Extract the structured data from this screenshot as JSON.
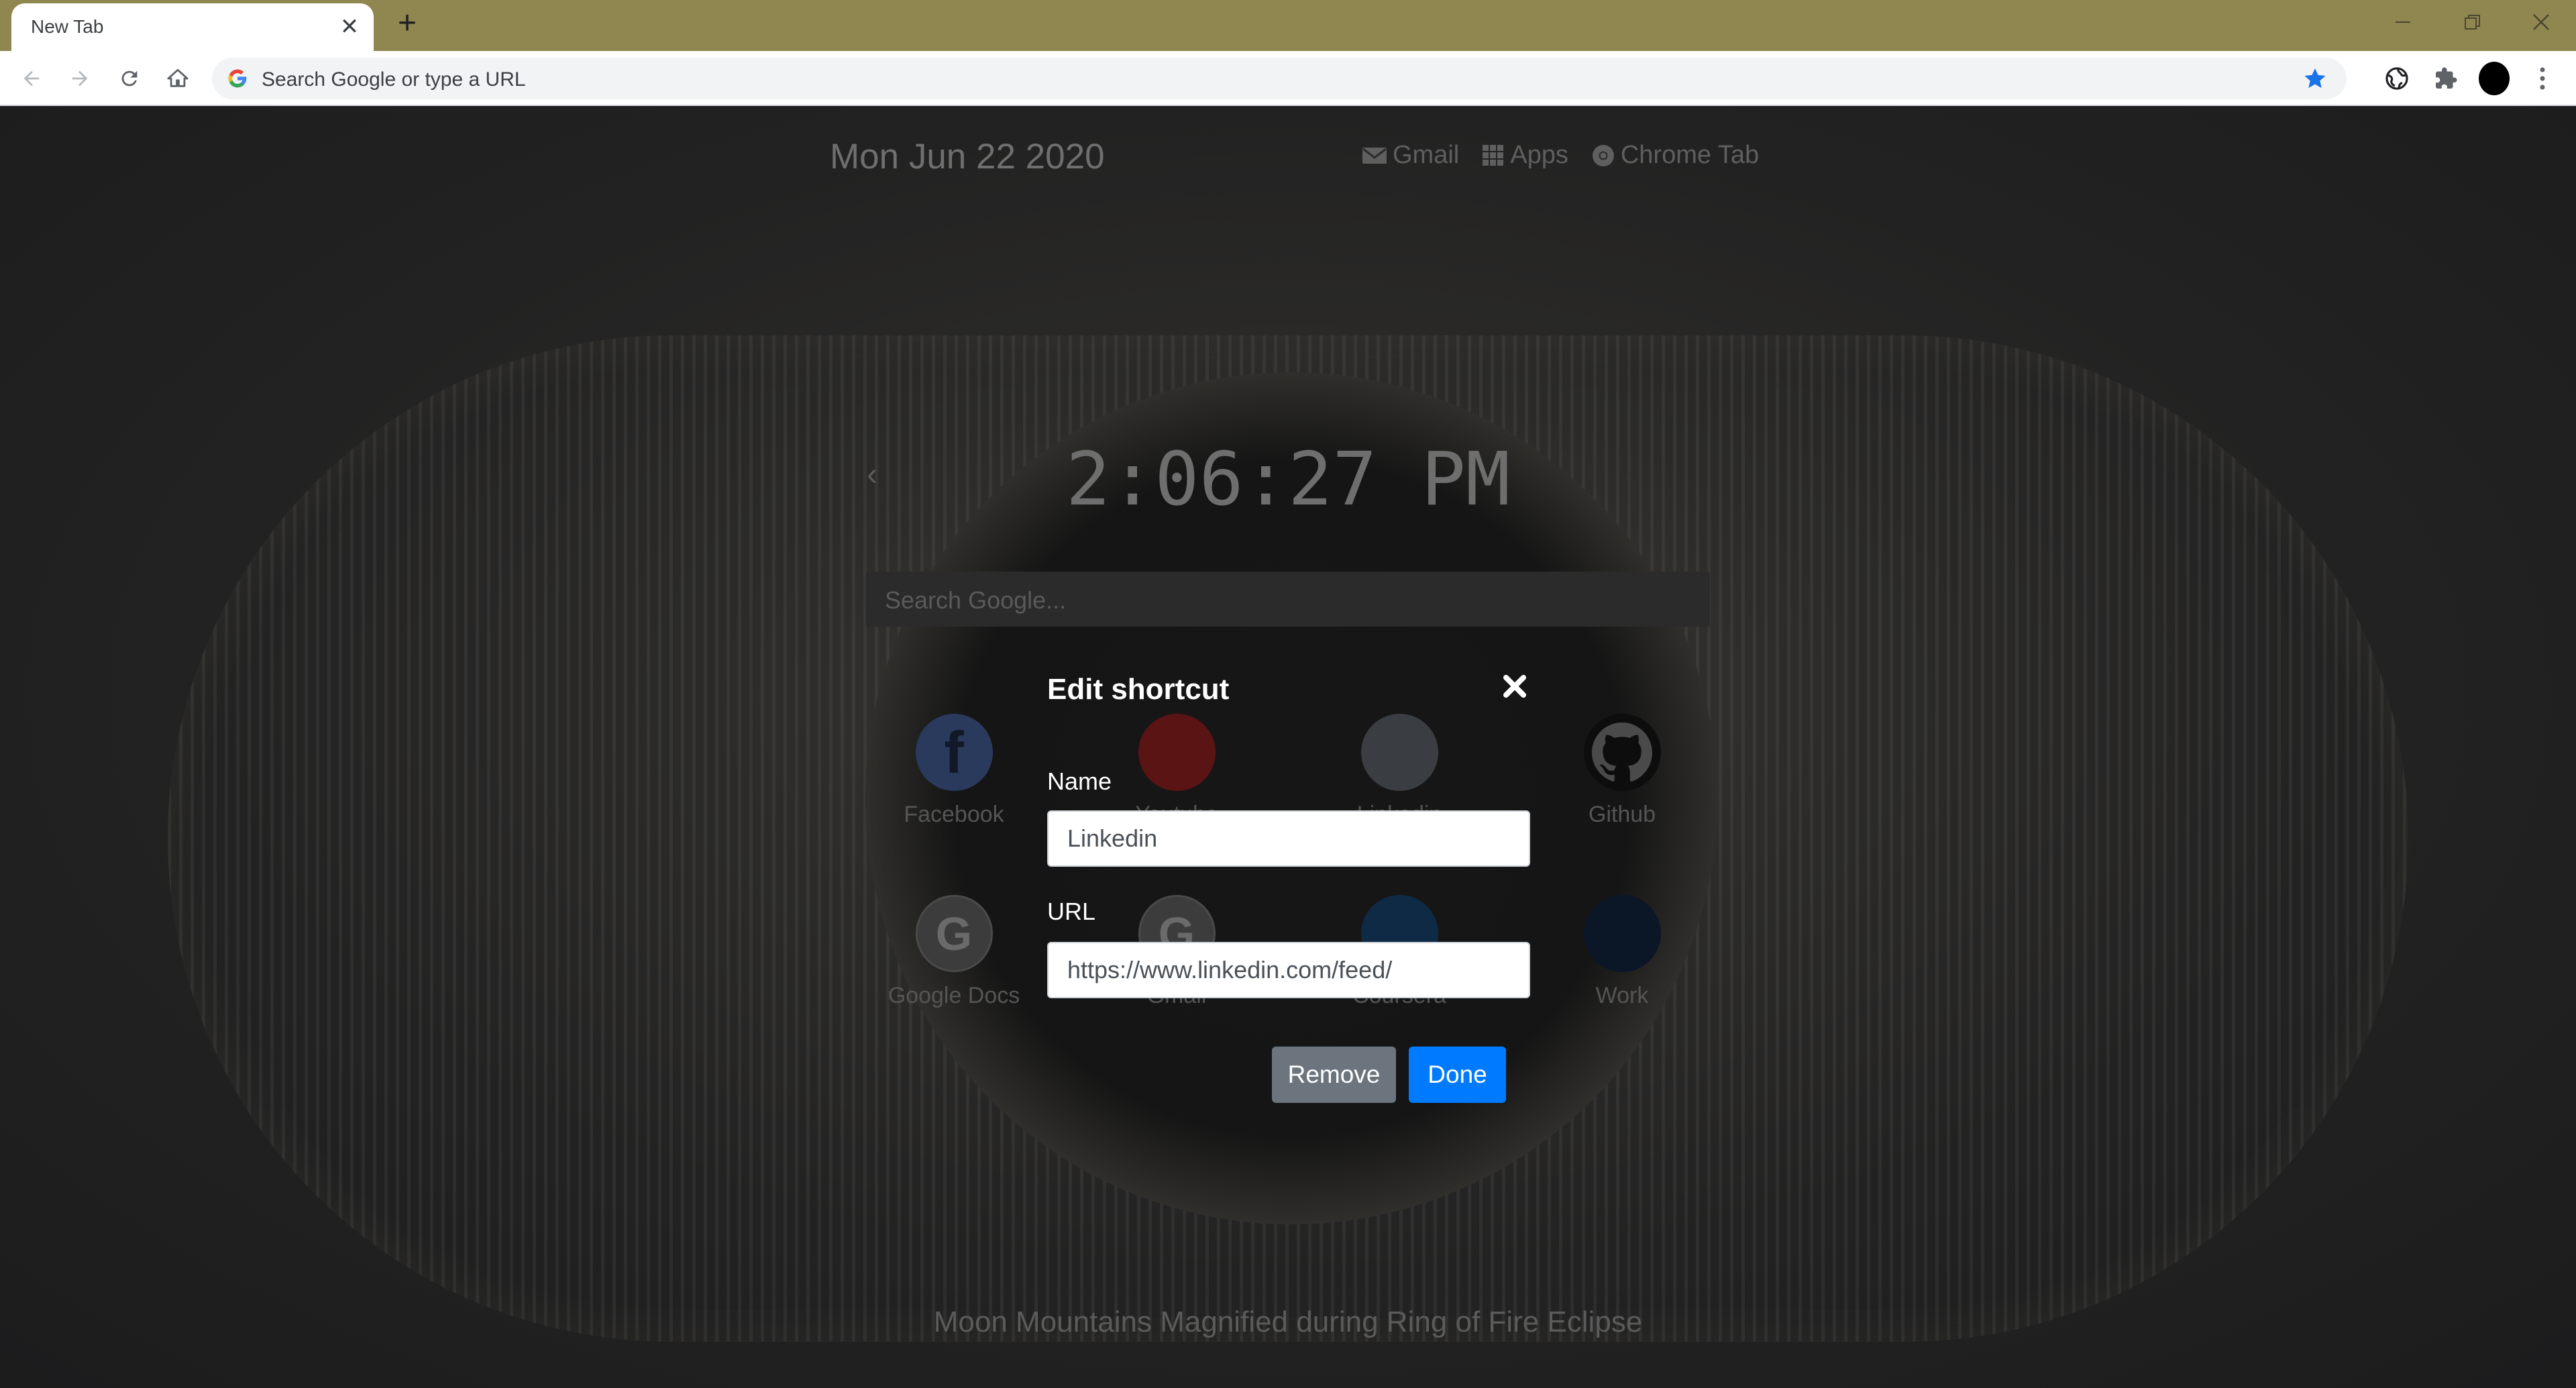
{
  "browser": {
    "tab_title": "New Tab",
    "tab_close": "✕",
    "new_tab": "+",
    "omnibox_placeholder": "Search Google or type a URL"
  },
  "page": {
    "date": "Mon Jun 22 2020",
    "top_links": [
      {
        "label": "Gmail",
        "icon": "envelope-icon"
      },
      {
        "label": "Apps",
        "icon": "grid-icon"
      },
      {
        "label": "Chrome Tab",
        "icon": "chrome-icon"
      }
    ],
    "clock": "2:06:27 PM",
    "search_placeholder": "Search Google...",
    "shortcuts": [
      {
        "label": "Facebook"
      },
      {
        "label": "Youtube"
      },
      {
        "label": "Linkedin"
      },
      {
        "label": "Github"
      },
      {
        "label": "Google Docs"
      },
      {
        "label": "Gmail"
      },
      {
        "label": "Coursera"
      },
      {
        "label": "Work"
      }
    ],
    "caption": "Moon Mountains Magnified during Ring of Fire Eclipse"
  },
  "modal": {
    "title": "Edit shortcut",
    "name_label": "Name",
    "name_value": "Linkedin",
    "url_label": "URL",
    "url_value": "https://www.linkedin.com/feed/",
    "remove_label": "Remove",
    "done_label": "Done"
  },
  "colors": {
    "tabstrip": "#8f8650",
    "primary_button": "#007bff",
    "secondary_button": "#6c757d",
    "star": "#1a73e8"
  }
}
